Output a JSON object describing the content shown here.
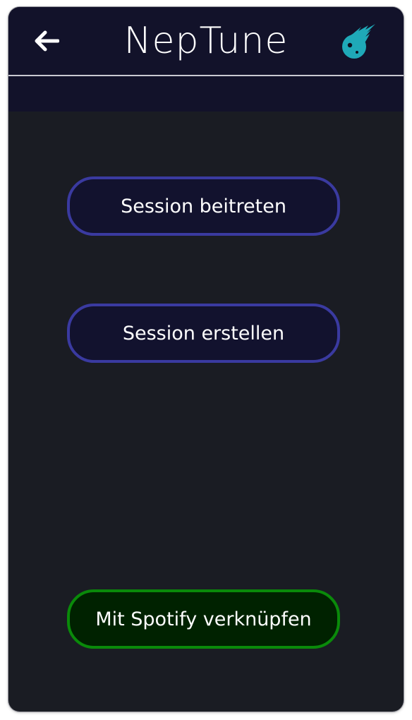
{
  "header": {
    "title": "NepTune",
    "back_icon": "arrow-left-icon",
    "logo_icon": "comet-logo-icon"
  },
  "actions": {
    "join_session": "Session beitreten",
    "create_session": "Session erstellen",
    "link_spotify": "Mit Spotify verknüpfen"
  },
  "colors": {
    "background": "#1a1c23",
    "header": "#12122a",
    "session_button_border": "#3a3aa0",
    "spotify_button_border": "#0a8a0a",
    "logo": "#1fa9b8"
  }
}
